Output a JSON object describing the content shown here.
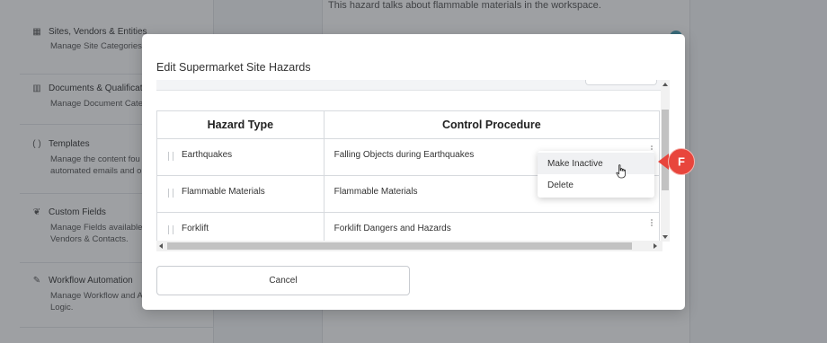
{
  "background": {
    "sidebar_items": [
      {
        "icon": "building-icon",
        "glyph": "▦",
        "title": "Sites, Vendors & Entities",
        "desc_lines": [
          "Manage Site Categories,"
        ]
      },
      {
        "icon": "books-icon",
        "glyph": "▥",
        "title": "Documents & Qualificat",
        "desc_lines": [
          "Manage Document Cate"
        ]
      },
      {
        "icon": "braces-icon",
        "glyph": "( )",
        "title": "Templates",
        "desc_lines": [
          "Manage the content fou",
          "automated emails and o"
        ]
      },
      {
        "icon": "leaf-icon",
        "glyph": "❦",
        "title": "Custom Fields",
        "desc_lines": [
          "Manage Fields available",
          "Vendors & Contacts."
        ]
      },
      {
        "icon": "magic-wand-icon",
        "glyph": "✎",
        "title": "Workflow Automation",
        "desc_lines": [
          "Manage Workflow and A",
          "Logic."
        ]
      }
    ],
    "center_text": "This hazard talks about flammable materials in the workspace."
  },
  "modal": {
    "title": "Edit Supermarket Site Hazards",
    "columns": [
      "Hazard Type",
      "Control Procedure"
    ],
    "rows": [
      {
        "hazard": "Earthquakes",
        "procedure": "Falling Objects during Earthquakes"
      },
      {
        "hazard": "Flammable Materials",
        "procedure": "Flammable Materials"
      },
      {
        "hazard": "Forklift",
        "procedure": "Forklift Dangers and Hazards"
      }
    ],
    "cancel_label": "Cancel"
  },
  "context_menu": {
    "items": [
      "Make Inactive",
      "Delete"
    ],
    "hovered": "Make Inactive"
  },
  "marker": {
    "label": "F",
    "color": "#e8453c"
  }
}
